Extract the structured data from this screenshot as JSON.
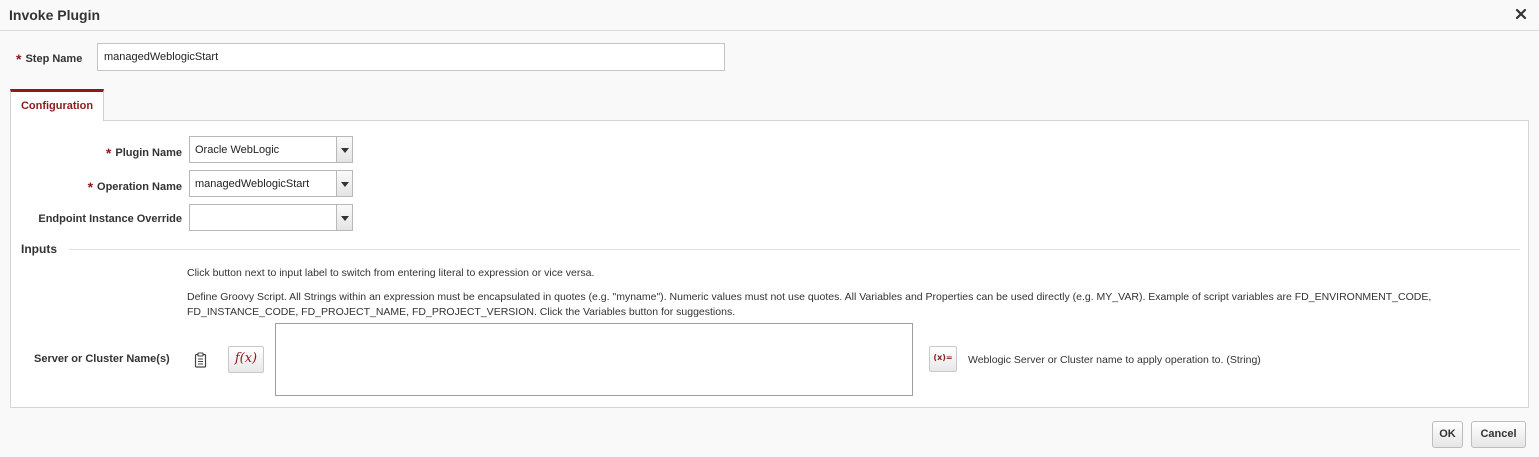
{
  "dialog": {
    "title": "Invoke Plugin"
  },
  "step": {
    "required_mark": "*",
    "label": "Step Name",
    "value": "managedWeblogicStart"
  },
  "tabs": [
    {
      "label": "Configuration",
      "active": true
    }
  ],
  "config": {
    "plugin_name": {
      "required_mark": "*",
      "label": "Plugin Name",
      "value": "Oracle WebLogic"
    },
    "operation_name": {
      "required_mark": "*",
      "label": "Operation Name",
      "value": "managedWeblogicStart"
    },
    "endpoint_override": {
      "label": "Endpoint Instance Override",
      "value": ""
    }
  },
  "inputs": {
    "title": "Inputs",
    "help_line1": "Click button next to input label to switch from entering literal to expression or vice versa.",
    "help_line2": "Define Groovy Script. All Strings within an expression must be encapsulated in quotes (e.g. \"myname\"). Numeric values must not use quotes. All Variables and Properties can be used directly (e.g. MY_VAR). Example of script variables are FD_ENVIRONMENT_CODE,",
    "help_line3": "FD_INSTANCE_CODE, FD_PROJECT_NAME, FD_PROJECT_VERSION. Click the Variables button for suggestions.",
    "server_label": "Server or Cluster Name(s)",
    "fx_label": "f(x)",
    "vars_label": "(x)=",
    "server_value": "",
    "server_desc": "Weblogic Server or Cluster name to apply operation to. (String)"
  },
  "footer": {
    "ok_label": "OK",
    "cancel_label": "Cancel"
  },
  "colors": {
    "accent": "#8b1a1a",
    "background": "#f9f9f9"
  },
  "icons": {
    "close": "close-icon",
    "clipboard": "clipboard-icon",
    "expression": "function-icon",
    "variables": "variables-icon",
    "dropdown": "chevron-down-icon"
  }
}
